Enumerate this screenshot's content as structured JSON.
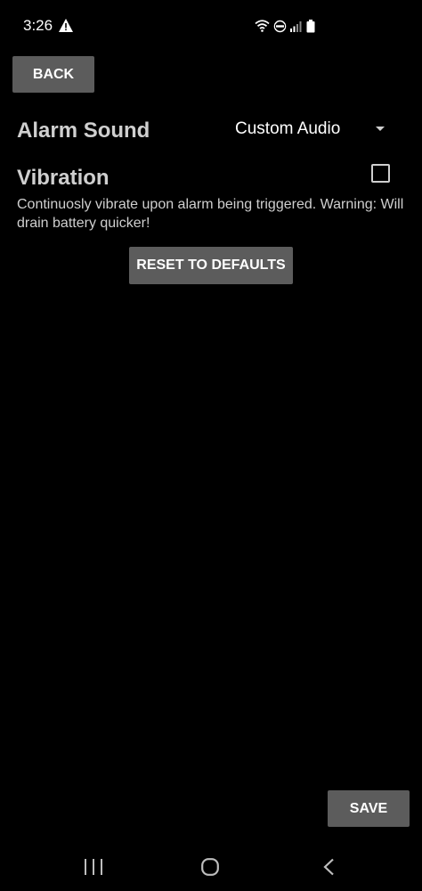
{
  "status_bar": {
    "time": "3:26",
    "icons": [
      "warning-icon",
      "wifi-icon",
      "volte-icon",
      "signal-icon",
      "battery-icon"
    ]
  },
  "toolbar": {
    "back_label": "BACK"
  },
  "alarm_sound": {
    "label": "Alarm Sound",
    "selected_value": "Custom Audio"
  },
  "vibration": {
    "label": "Vibration",
    "checked": false,
    "description": "Continuosly vibrate upon alarm being triggered. Warning: Will drain battery quicker!"
  },
  "actions": {
    "reset_label": "RESET TO DEFAULTS",
    "save_label": "SAVE"
  },
  "colors": {
    "background": "#000000",
    "button_bg": "#5c5c5c",
    "label_text": "#cfcfcf"
  }
}
